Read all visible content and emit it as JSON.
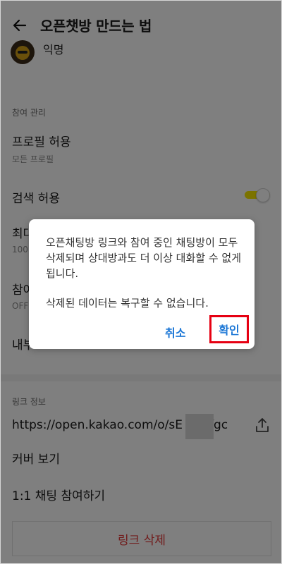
{
  "header": {
    "title": "오픈챗방 만드는 법"
  },
  "profile": {
    "name": "익명"
  },
  "participation": {
    "section_label": "참여 관리",
    "profile_allow_title": "프로필 허용",
    "profile_allow_value": "모든 프로필",
    "search_allow_title": "검색 허용",
    "search_allow_on": true,
    "max_title": "최대",
    "max_value": "100",
    "join_title": "참여",
    "join_value": "OFF",
    "internal_title": "내부"
  },
  "link_info": {
    "section_label": "링크 정보",
    "url_prefix": "https://open.kakao.com/o/sE",
    "url_suffix": "fgc",
    "cover_view": "커버 보기",
    "one_to_one": "1:1 채팅 참여하기",
    "delete_link": "링크 삭제"
  },
  "dialog": {
    "message": "오픈채팅방 링크와 참여 중인 채팅방이 모두 삭제되며 상대방과도 더 이상 대화할 수 없게 됩니다.",
    "message2": "삭제된 데이터는 복구할 수 없습니다.",
    "cancel_label": "취소",
    "confirm_label": "확인"
  },
  "colors": {
    "accent": "#1e78d6",
    "toggle_on": "#f7e600",
    "danger": "#e23b3b",
    "highlight": "#e60012"
  }
}
